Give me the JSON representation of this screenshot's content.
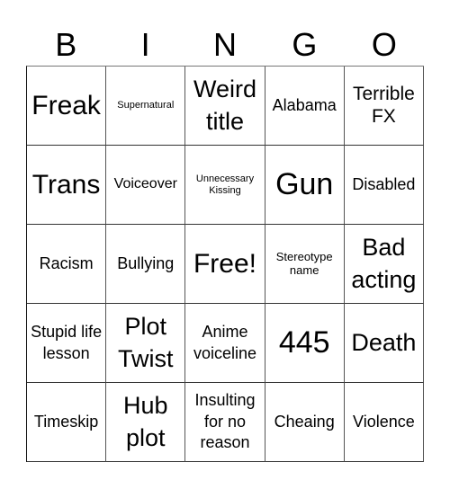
{
  "header": [
    "B",
    "I",
    "N",
    "G",
    "O"
  ],
  "cells": [
    {
      "text": "Freak",
      "size": "s-xxl"
    },
    {
      "text": "Supernatural",
      "size": "s-xs"
    },
    {
      "text": "Weird title",
      "size": "s-xl"
    },
    {
      "text": "Alabama",
      "size": "s-md2"
    },
    {
      "text": "Terrible FX",
      "size": "s-lg"
    },
    {
      "text": "Trans",
      "size": "s-xxl"
    },
    {
      "text": "Voiceover",
      "size": "s-md"
    },
    {
      "text": "Unnecessary Kissing",
      "size": "s-xs"
    },
    {
      "text": "Gun",
      "size": "s-huge"
    },
    {
      "text": "Disabled",
      "size": "s-md2"
    },
    {
      "text": "Racism",
      "size": "s-md2"
    },
    {
      "text": "Bullying",
      "size": "s-md2"
    },
    {
      "text": "Free!",
      "size": "s-xxl"
    },
    {
      "text": "Stereotype name",
      "size": "s-sm"
    },
    {
      "text": "Bad acting",
      "size": "s-xl"
    },
    {
      "text": "Stupid life lesson",
      "size": "s-md2"
    },
    {
      "text": "Plot Twist",
      "size": "s-xl"
    },
    {
      "text": "Anime voiceline",
      "size": "s-md2"
    },
    {
      "text": "445",
      "size": "s-huge"
    },
    {
      "text": "Death",
      "size": "s-xl"
    },
    {
      "text": "Timeskip",
      "size": "s-md2"
    },
    {
      "text": "Hub plot",
      "size": "s-xl"
    },
    {
      "text": "Insulting for no reason",
      "size": "s-md2"
    },
    {
      "text": "Cheaing",
      "size": "s-md2"
    },
    {
      "text": "Violence",
      "size": "s-md2"
    }
  ]
}
